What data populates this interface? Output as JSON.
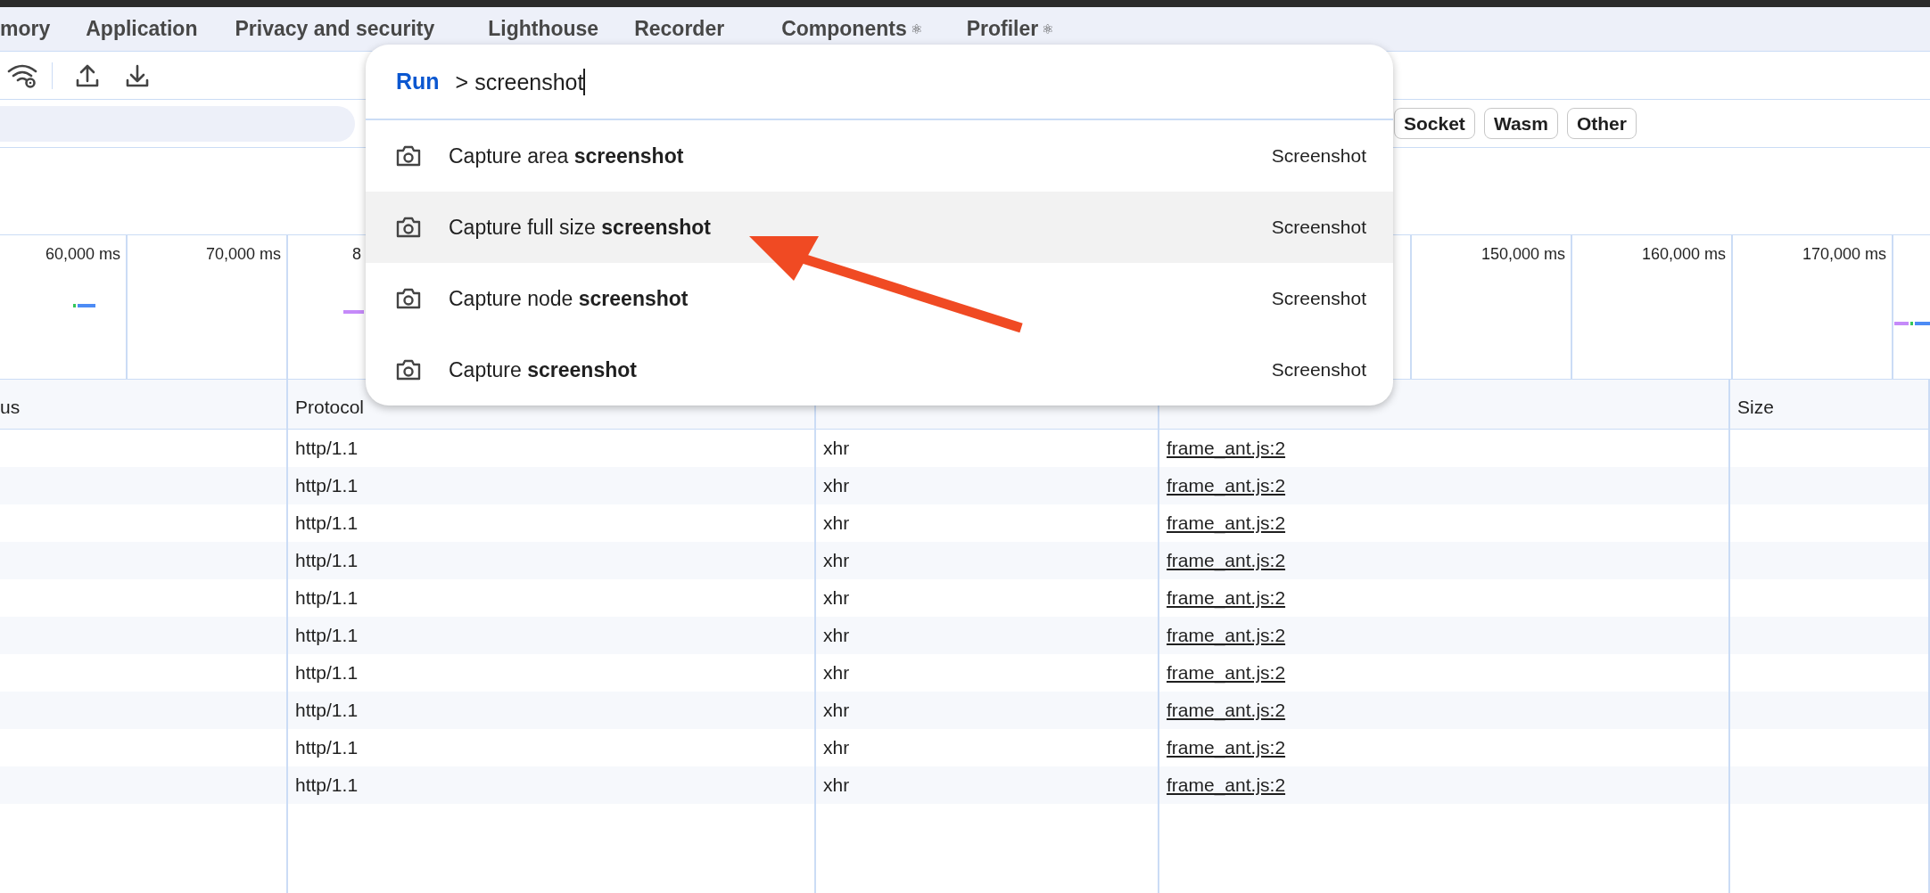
{
  "tabs": [
    {
      "label": "mory"
    },
    {
      "label": "Application"
    },
    {
      "label": "Privacy and security"
    },
    {
      "label": "Lighthouse"
    },
    {
      "label": "Recorder"
    },
    {
      "label": "Components",
      "icon": "⚛"
    },
    {
      "label": "Profiler",
      "icon": "⚛"
    }
  ],
  "type_filters": [
    "Socket",
    "Wasm",
    "Other"
  ],
  "timeline": {
    "columns": [
      {
        "label": "60,000 ms"
      },
      {
        "label": "70,000 ms"
      },
      {
        "label": "8",
        "clipped": true
      },
      {},
      {},
      {},
      {},
      {},
      {},
      {
        "label": "150,000 ms"
      },
      {
        "label": "160,000 ms"
      },
      {
        "label": "170,000 ms"
      },
      {}
    ]
  },
  "table": {
    "columns": [
      {
        "label": "us"
      },
      {
        "label": "Protocol"
      },
      {},
      {},
      {
        "label": "Size"
      }
    ],
    "rows": [
      {
        "protocol": "http/1.1",
        "type": "xhr",
        "initiator": "frame_ant.js:2"
      },
      {
        "protocol": "http/1.1",
        "type": "xhr",
        "initiator": "frame_ant.js:2"
      },
      {
        "protocol": "http/1.1",
        "type": "xhr",
        "initiator": "frame_ant.js:2"
      },
      {
        "protocol": "http/1.1",
        "type": "xhr",
        "initiator": "frame_ant.js:2"
      },
      {
        "protocol": "http/1.1",
        "type": "xhr",
        "initiator": "frame_ant.js:2"
      },
      {
        "protocol": "http/1.1",
        "type": "xhr",
        "initiator": "frame_ant.js:2"
      },
      {
        "protocol": "http/1.1",
        "type": "xhr",
        "initiator": "frame_ant.js:2"
      },
      {
        "protocol": "http/1.1",
        "type": "xhr",
        "initiator": "frame_ant.js:2"
      },
      {
        "protocol": "http/1.1",
        "type": "xhr",
        "initiator": "frame_ant.js:2"
      },
      {
        "protocol": "http/1.1",
        "type": "xhr",
        "initiator": "frame_ant.js:2"
      }
    ]
  },
  "command_menu": {
    "prompt": "Run",
    "query": "> screenshot",
    "items": [
      {
        "label": "Capture area **screenshot**",
        "category": "Screenshot",
        "selected": false
      },
      {
        "label": "Capture full size **screenshot**",
        "category": "Screenshot",
        "selected": true
      },
      {
        "label": "Capture node **screenshot**",
        "category": "Screenshot",
        "selected": false
      },
      {
        "label": "Capture **screenshot**",
        "category": "Screenshot",
        "selected": false
      }
    ]
  }
}
